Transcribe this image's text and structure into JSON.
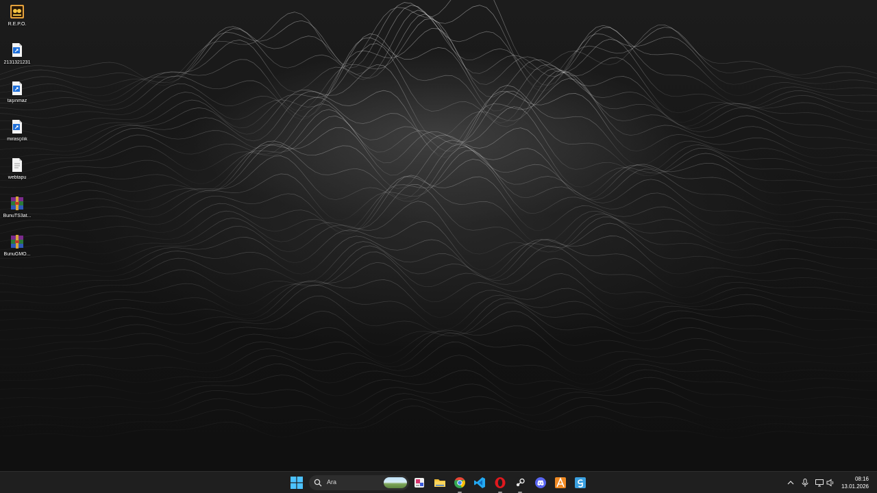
{
  "desktop": {
    "icons": [
      {
        "label": "R.E.P.O.",
        "icon": "repo-game-icon"
      },
      {
        "label": "2131321231",
        "icon": "shortcut-file-icon"
      },
      {
        "label": "taşınmaz",
        "icon": "shortcut-file-icon"
      },
      {
        "label": "mirasçılık",
        "icon": "shortcut-file-icon"
      },
      {
        "label": "webtapu",
        "icon": "text-file-icon"
      },
      {
        "label": "BunuTS3at...",
        "icon": "winrar-archive-icon"
      },
      {
        "label": "BunuGMO...",
        "icon": "winrar-archive-icon"
      }
    ]
  },
  "taskbar": {
    "search_placeholder": "Ara",
    "apps": [
      {
        "name": "snipping-tool",
        "icon": "snipping-tool-icon"
      },
      {
        "name": "file-explorer",
        "icon": "folder-icon"
      },
      {
        "name": "chrome",
        "icon": "chrome-icon"
      },
      {
        "name": "vscode",
        "icon": "vscode-icon"
      },
      {
        "name": "opera",
        "icon": "opera-icon"
      },
      {
        "name": "steam",
        "icon": "steam-icon"
      },
      {
        "name": "discord",
        "icon": "discord-icon"
      },
      {
        "name": "app-orange",
        "icon": "orange-a-icon"
      },
      {
        "name": "app-blue-g",
        "icon": "blue-g-icon"
      }
    ],
    "tray": {
      "time": "08:16",
      "date": "13.01.2026"
    }
  },
  "colors": {
    "taskbar_bg": "#1f1f1f",
    "start_blue": "#4cc2ff",
    "wallpaper_bg": "#141414"
  }
}
